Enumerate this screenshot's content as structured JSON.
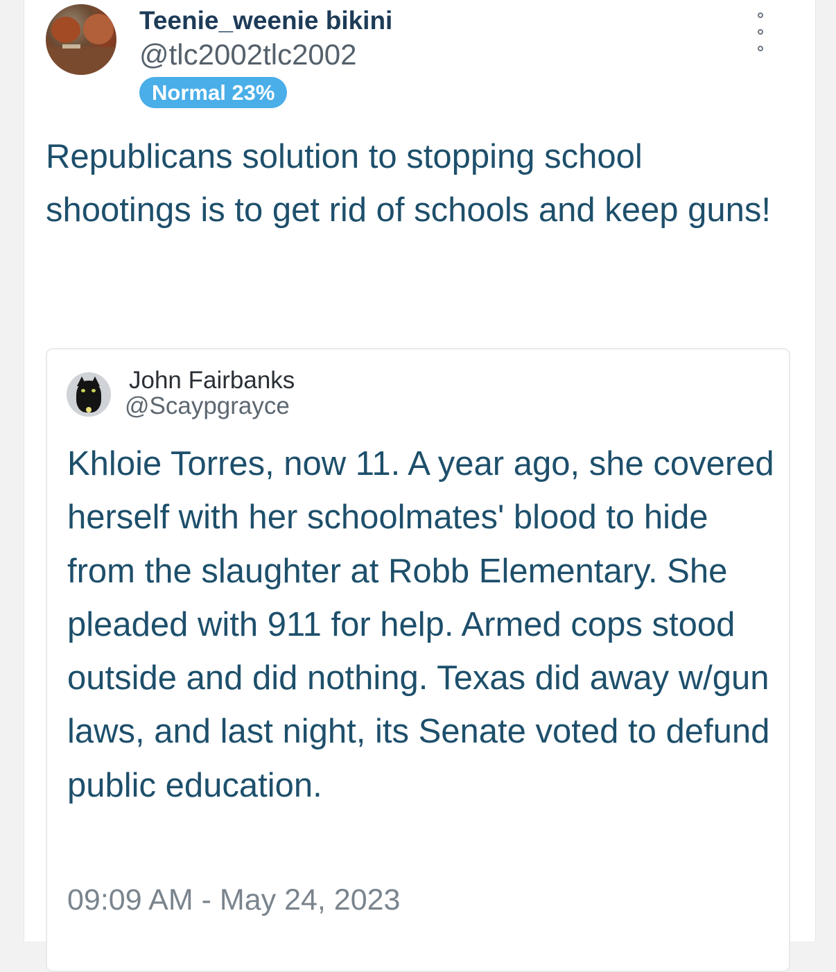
{
  "post": {
    "display_name": "Teenie_weenie bikini",
    "handle": "@tlc2002tlc2002",
    "badge": "Normal 23%",
    "text": "Republicans solution to stopping school shootings is to get rid of schools and keep guns!",
    "menu_icon": "more-vertical-icon"
  },
  "quoted": {
    "display_name": "John Fairbanks",
    "handle": "@Scaypgrayce",
    "text": "Khloie Torres, now 11. A year ago, she covered herself with her schoolmates' blood to hide from the slaughter at Robb Elementary. She pleaded with 911 for help. Armed cops stood outside and did nothing. Texas did away w/gun laws, and last night, its Senate voted to defund public education.",
    "timestamp": "09:09 AM - May 24, 2023"
  },
  "colors": {
    "badge_bg": "#4aaee8",
    "body_text": "#1d4f6b",
    "name_text": "#1d3b57"
  }
}
